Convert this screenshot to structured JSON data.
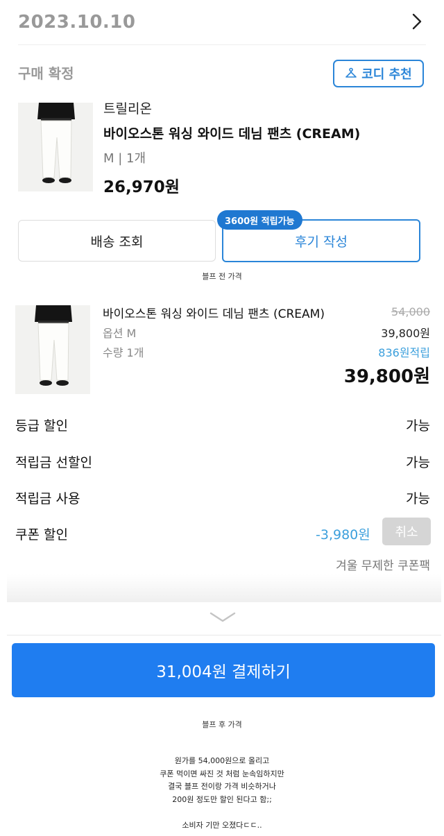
{
  "order": {
    "date": "2023.10.10",
    "status": "구매 확정",
    "codi_label": "코디 추천"
  },
  "product": {
    "brand": "트릴리온",
    "name": "바이오스톤 워싱 와이드 데님 팬츠 (CREAM)",
    "option": "M | 1개",
    "price": "26,970원"
  },
  "actions": {
    "shipping_label": "배송 조회",
    "review_label": "후기 작성",
    "review_badge": "3600원 적립가능"
  },
  "captions": {
    "before": "블프 전 가격",
    "after": "블프 후 가격"
  },
  "checkout_item": {
    "name": "바이오스톤 워싱 와이드 데님 팬츠 (CREAM)",
    "option": "옵션 M",
    "quantity": "수량 1개",
    "original_price": "54,000",
    "sale_price": "39,800원",
    "points": "836원적립",
    "total": "39,800원"
  },
  "discounts": [
    {
      "label": "등급 할인",
      "value": "가능"
    },
    {
      "label": "적립금 선할인",
      "value": "가능"
    },
    {
      "label": "적립금 사용",
      "value": "가능"
    },
    {
      "label": "쿠폰 할인",
      "value": "-3,980원"
    }
  ],
  "coupon": {
    "cancel_label": "취소",
    "pack_name": "겨울 무제한 쿠폰팩"
  },
  "payment": {
    "button_label": "31,004원 결제하기"
  },
  "note_lines": [
    "원가를 54,000원으로 올리고",
    "쿠폰 먹이면 싸진 것 처럼 눈속임하지만",
    "결국 블프 전이랑 가격 비슷하거나",
    "200원 정도만 할인 된다고 함;;",
    "",
    "소비자 기만 오졌다ㄷㄷ.."
  ],
  "colors": {
    "accent_blue": "#2a85d8",
    "pay_button": "#1f7df0",
    "points_blue": "#3b9fdc"
  }
}
